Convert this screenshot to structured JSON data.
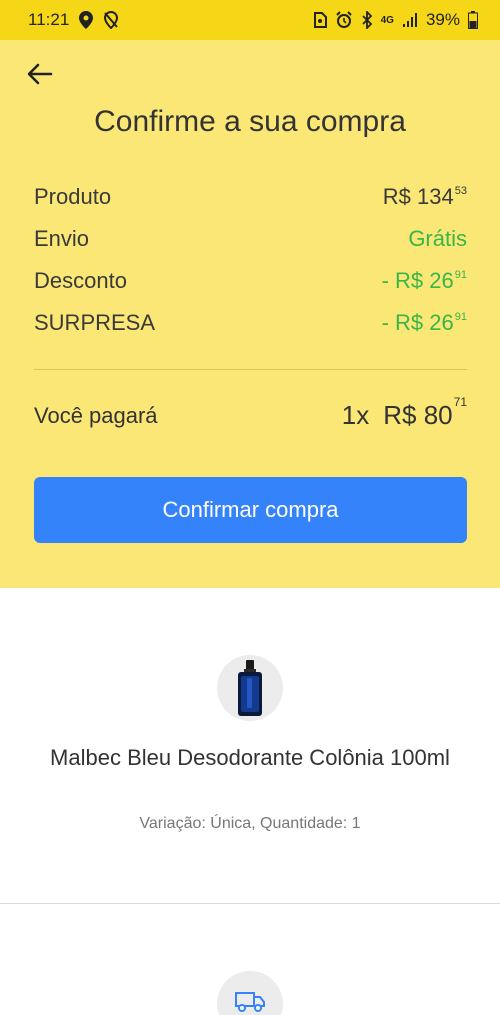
{
  "status_bar": {
    "time": "11:21",
    "battery": "39%",
    "network": "4G",
    "icons": [
      "location-icon",
      "location-off-icon",
      "sim-icon",
      "alarm-icon",
      "bluetooth-icon",
      "signal-icon",
      "battery-icon"
    ]
  },
  "header": {
    "back_icon": "arrow-left-icon",
    "title": "Confirme a sua compra"
  },
  "summary": {
    "rows": [
      {
        "label": "Produto",
        "prefix": "R$ 134",
        "cents": "53",
        "color": "#3a3a3a"
      },
      {
        "label": "Envio",
        "prefix": "Grátis",
        "cents": "",
        "color": "#39b54a"
      },
      {
        "label": "Desconto",
        "prefix": "- R$ 26",
        "cents": "91",
        "color": "#39b54a"
      },
      {
        "label": "SURPRESA",
        "prefix": "- R$ 26",
        "cents": "91",
        "color": "#39b54a"
      }
    ],
    "total_label": "Você pagará",
    "installments": "1x",
    "total_prefix": "R$ 80",
    "total_cents": "71"
  },
  "confirm_button": {
    "label": "Confirmar compra",
    "color": "#3483fa"
  },
  "product": {
    "name": "Malbec Bleu Desodorante Colônia 100ml",
    "variation": "Variação: Única, Quantidade: 1"
  },
  "shipping": {
    "icon": "truck-icon"
  },
  "colors": {
    "header_bg": "#fbe776",
    "status_bg": "#f5d718",
    "green": "#39b54a"
  }
}
